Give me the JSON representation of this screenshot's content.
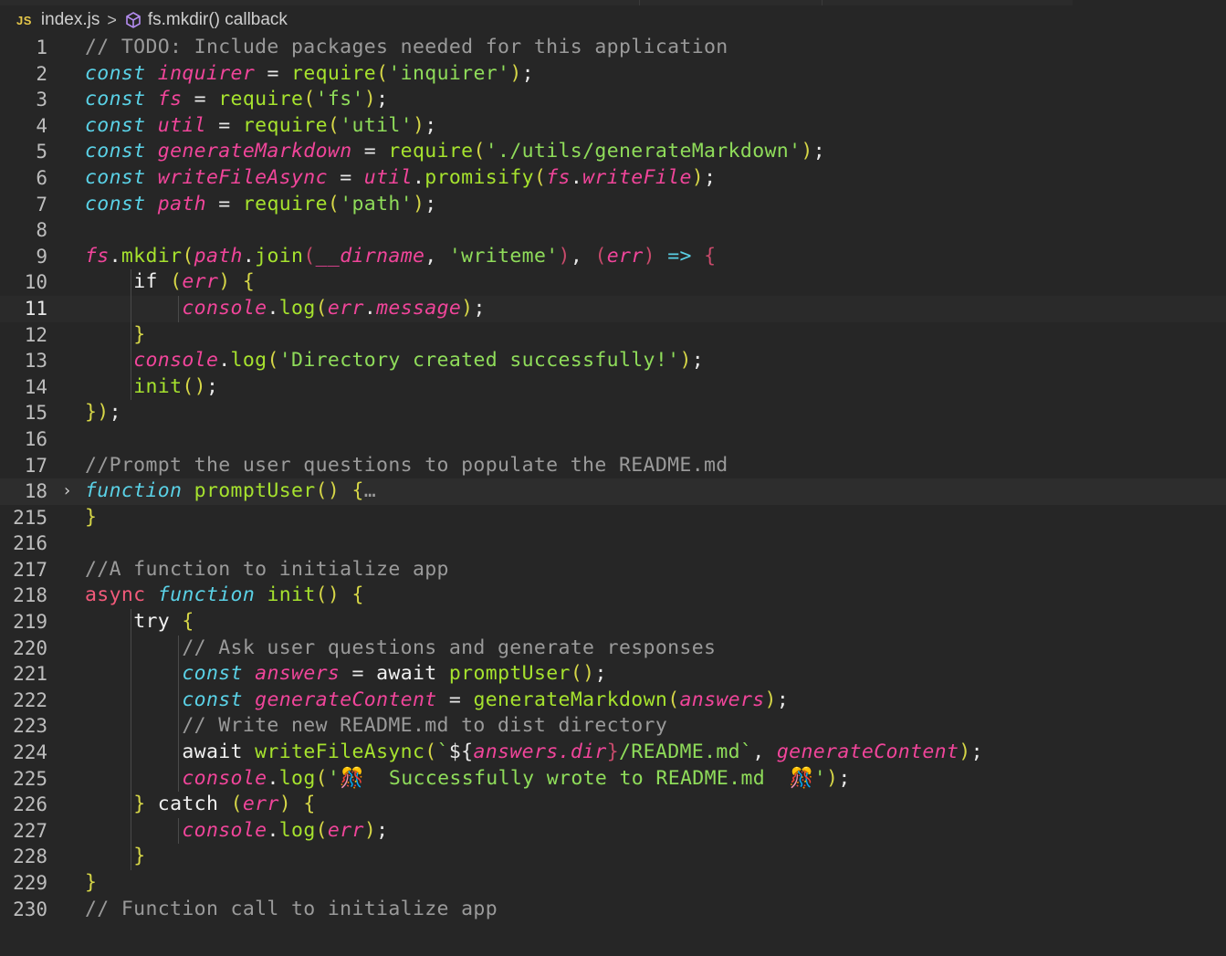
{
  "breadcrumb": {
    "file_badge": "JS",
    "file_name": "index.js",
    "separator": ">",
    "symbol_icon": "cube-icon",
    "symbol": "fs.mkdir() callback"
  },
  "editor": {
    "current_line": "11",
    "folded_line": "18",
    "lines": [
      {
        "num": "1",
        "text": "// TODO: Include packages needed for this application"
      },
      {
        "num": "2",
        "text": "const inquirer = require('inquirer');"
      },
      {
        "num": "3",
        "text": "const fs = require('fs');"
      },
      {
        "num": "4",
        "text": "const util = require('util');"
      },
      {
        "num": "5",
        "text": "const generateMarkdown = require('./utils/generateMarkdown');"
      },
      {
        "num": "6",
        "text": "const writeFileAsync = util.promisify(fs.writeFile);"
      },
      {
        "num": "7",
        "text": "const path = require('path');"
      },
      {
        "num": "8",
        "text": ""
      },
      {
        "num": "9",
        "text": "fs.mkdir(path.join(__dirname, 'writeme'), (err) => {"
      },
      {
        "num": "10",
        "text": "    if (err) {"
      },
      {
        "num": "11",
        "text": "        console.log(err.message);"
      },
      {
        "num": "12",
        "text": "    }"
      },
      {
        "num": "13",
        "text": "    console.log('Directory created successfully!');"
      },
      {
        "num": "14",
        "text": "    init();"
      },
      {
        "num": "15",
        "text": "});"
      },
      {
        "num": "16",
        "text": ""
      },
      {
        "num": "17",
        "text": "//Prompt the user questions to populate the README.md"
      },
      {
        "num": "18",
        "text": "function promptUser() {…"
      },
      {
        "num": "215",
        "text": "}"
      },
      {
        "num": "216",
        "text": ""
      },
      {
        "num": "217",
        "text": "//A function to initialize app"
      },
      {
        "num": "218",
        "text": "async function init() {"
      },
      {
        "num": "219",
        "text": "    try {"
      },
      {
        "num": "220",
        "text": "        // Ask user questions and generate responses"
      },
      {
        "num": "221",
        "text": "        const answers = await promptUser();"
      },
      {
        "num": "222",
        "text": "        const generateContent = generateMarkdown(answers);"
      },
      {
        "num": "223",
        "text": "        // Write new README.md to dist directory"
      },
      {
        "num": "224",
        "text": "        await writeFileAsync(`${answers.dir}/README.md`, generateContent);"
      },
      {
        "num": "225",
        "text": "        console.log('🎊  Successfully wrote to README.md  🎊');"
      },
      {
        "num": "226",
        "text": "    } catch (err) {"
      },
      {
        "num": "227",
        "text": "        console.log(err);"
      },
      {
        "num": "228",
        "text": "    }"
      },
      {
        "num": "229",
        "text": "}"
      },
      {
        "num": "230",
        "text": "// Function call to initialize app"
      }
    ]
  }
}
